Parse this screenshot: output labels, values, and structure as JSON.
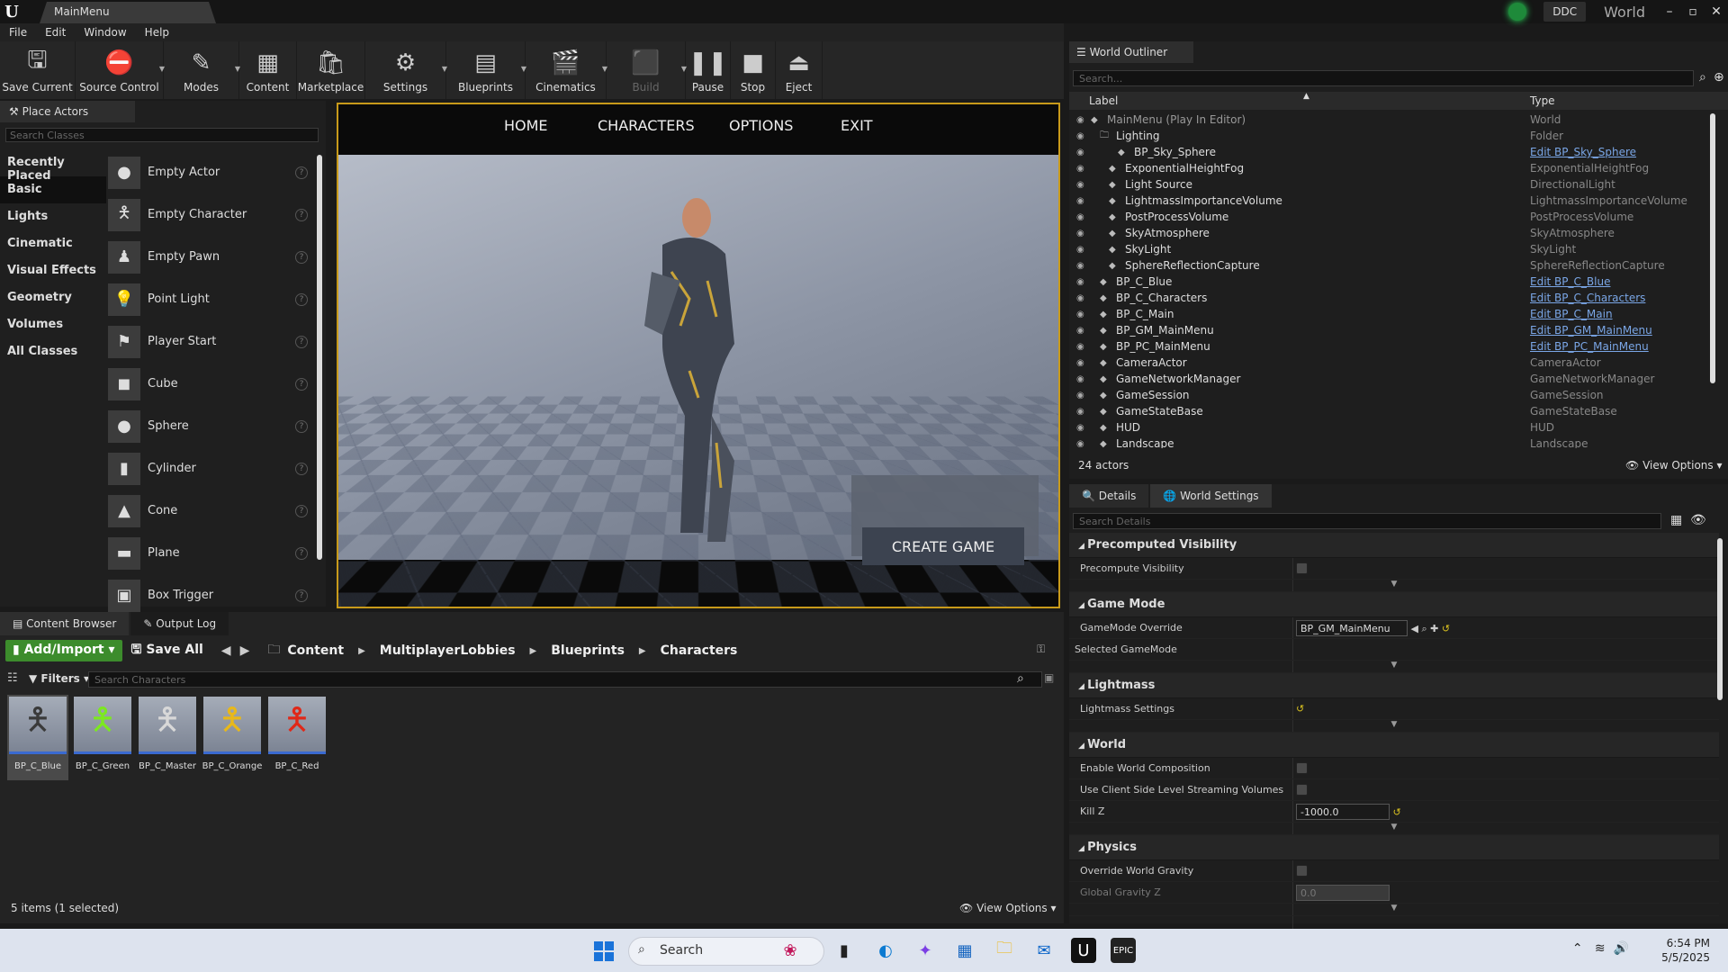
{
  "window": {
    "tab_title": "MainMenu",
    "ddc": "DDC",
    "world_label": "World"
  },
  "menu": [
    "File",
    "Edit",
    "Window",
    "Help"
  ],
  "toolbar": [
    {
      "label": "Save Current",
      "icon": "save-icon"
    },
    {
      "label": "Source Control",
      "icon": "source-control-icon"
    },
    {
      "label": "Modes",
      "icon": "modes-icon"
    },
    {
      "label": "Content",
      "icon": "content-icon"
    },
    {
      "label": "Marketplace",
      "icon": "marketplace-icon"
    },
    {
      "label": "Settings",
      "icon": "settings-icon"
    },
    {
      "label": "Blueprints",
      "icon": "blueprints-icon"
    },
    {
      "label": "Cinematics",
      "icon": "cinematics-icon"
    },
    {
      "label": "Build",
      "icon": "build-icon"
    },
    {
      "label": "Pause",
      "icon": "pause-icon"
    },
    {
      "label": "Stop",
      "icon": "stop-icon"
    },
    {
      "label": "Eject",
      "icon": "eject-icon"
    }
  ],
  "place_actors": {
    "tab": "Place Actors",
    "search_placeholder": "Search Classes",
    "categories": [
      "Recently Placed",
      "Basic",
      "Lights",
      "Cinematic",
      "Visual Effects",
      "Geometry",
      "Volumes",
      "All Classes"
    ],
    "selected_category": "Basic",
    "items": [
      "Empty Actor",
      "Empty Character",
      "Empty Pawn",
      "Point Light",
      "Player Start",
      "Cube",
      "Sphere",
      "Cylinder",
      "Cone",
      "Plane",
      "Box Trigger"
    ]
  },
  "viewport": {
    "nav": [
      "HOME",
      "CHARACTERS",
      "OPTIONS",
      "EXIT"
    ],
    "create_button": "CREATE GAME"
  },
  "outliner": {
    "tab": "World Outliner",
    "search_placeholder": "Search...",
    "col_label": "Label",
    "col_type": "Type",
    "rows": [
      {
        "label": "MainMenu (Play In Editor)",
        "type": "World",
        "link": false
      },
      {
        "label": "Lighting",
        "type": "Folder",
        "link": false
      },
      {
        "label": "BP_Sky_Sphere",
        "type": "Edit BP_Sky_Sphere",
        "link": true
      },
      {
        "label": "ExponentialHeightFog",
        "type": "ExponentialHeightFog",
        "link": false
      },
      {
        "label": "Light Source",
        "type": "DirectionalLight",
        "link": false
      },
      {
        "label": "LightmassImportanceVolume",
        "type": "LightmassImportanceVolume",
        "link": false
      },
      {
        "label": "PostProcessVolume",
        "type": "PostProcessVolume",
        "link": false
      },
      {
        "label": "SkyAtmosphere",
        "type": "SkyAtmosphere",
        "link": false
      },
      {
        "label": "SkyLight",
        "type": "SkyLight",
        "link": false
      },
      {
        "label": "SphereReflectionCapture",
        "type": "SphereReflectionCapture",
        "link": false
      },
      {
        "label": "BP_C_Blue",
        "type": "Edit BP_C_Blue",
        "link": true
      },
      {
        "label": "BP_C_Characters",
        "type": "Edit BP_C_Characters",
        "link": true
      },
      {
        "label": "BP_C_Main",
        "type": "Edit BP_C_Main",
        "link": true
      },
      {
        "label": "BP_GM_MainMenu",
        "type": "Edit BP_GM_MainMenu",
        "link": true
      },
      {
        "label": "BP_PC_MainMenu",
        "type": "Edit BP_PC_MainMenu",
        "link": true
      },
      {
        "label": "CameraActor",
        "type": "CameraActor",
        "link": false
      },
      {
        "label": "GameNetworkManager",
        "type": "GameNetworkManager",
        "link": false
      },
      {
        "label": "GameSession",
        "type": "GameSession",
        "link": false
      },
      {
        "label": "GameStateBase",
        "type": "GameStateBase",
        "link": false
      },
      {
        "label": "HUD",
        "type": "HUD",
        "link": false
      },
      {
        "label": "Landscape",
        "type": "Landscape",
        "link": false
      }
    ],
    "actor_count": "24 actors",
    "view_options": "View Options"
  },
  "details": {
    "tabs": [
      "Details",
      "World Settings"
    ],
    "search_placeholder": "Search Details",
    "sections": [
      {
        "title": "Precomputed Visibility",
        "props": [
          {
            "name": "Precompute Visibility",
            "kind": "check"
          }
        ]
      },
      {
        "title": "Game Mode",
        "props": [
          {
            "name": "GameMode Override",
            "kind": "combo",
            "value": "BP_GM_MainMenu"
          },
          {
            "name": "Selected GameMode",
            "kind": "none"
          }
        ]
      },
      {
        "title": "Lightmass",
        "props": [
          {
            "name": "Lightmass Settings",
            "kind": "reset"
          }
        ]
      },
      {
        "title": "World",
        "props": [
          {
            "name": "Enable World Composition",
            "kind": "check"
          },
          {
            "name": "Use Client Side Level Streaming Volumes",
            "kind": "check"
          },
          {
            "name": "Kill Z",
            "kind": "num",
            "value": "-1000.0"
          }
        ]
      },
      {
        "title": "Physics",
        "props": [
          {
            "name": "Override World Gravity",
            "kind": "check"
          },
          {
            "name": "Global Gravity Z",
            "kind": "num",
            "value": "0.0"
          }
        ]
      }
    ]
  },
  "content_browser": {
    "tabs": [
      "Content Browser",
      "Output Log"
    ],
    "add_import": "Add/Import",
    "save_all": "Save All",
    "path": [
      "Content",
      "MultiplayerLobbies",
      "Blueprints",
      "Characters"
    ],
    "filters": "Filters",
    "search_placeholder": "Search Characters",
    "assets": [
      {
        "name": "BP_C_Blue",
        "color": "#3a3a3a"
      },
      {
        "name": "BP_C_Green",
        "color": "#7ce820"
      },
      {
        "name": "BP_C_Master",
        "color": "#d8d8d8"
      },
      {
        "name": "BP_C_Orange",
        "color": "#e8b81a"
      },
      {
        "name": "BP_C_Red",
        "color": "#e02818"
      }
    ],
    "status": "5 items (1 selected)",
    "view_options": "View Options"
  },
  "taskbar": {
    "search": "Search",
    "time": "6:54 PM",
    "date": "5/5/2025"
  }
}
